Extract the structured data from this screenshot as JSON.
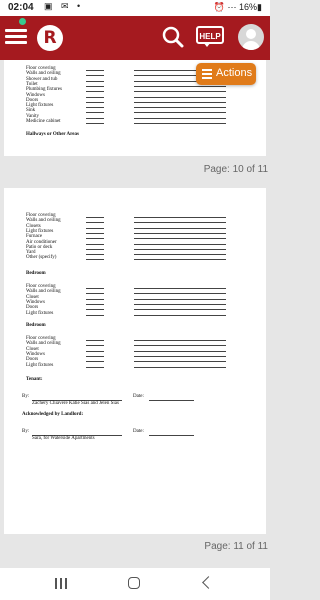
{
  "status_bar": {
    "time": "02:04",
    "notifications": "▣ ✉ •",
    "right": "⏰ ⋯ 16%▮"
  },
  "app_bar": {
    "logo": "R",
    "help_label": "HELP",
    "actions_label": "Actions"
  },
  "page10": {
    "items": [
      "Floor covering",
      "Walls and ceiling",
      "Shower and tub",
      "Toilet",
      "Plumbing fixtures",
      "Windows",
      "Doors",
      "Light fixtures",
      "Sink",
      "Vanity",
      "Medicine cabinet"
    ],
    "heading": "Hallways or Other Areas",
    "page_label": "Page: 10 of 11"
  },
  "page11": {
    "section1": [
      "Floor covering",
      "Walls and ceiling",
      "Closets",
      "Light fixtures",
      "Furnace",
      "Air conditioner",
      "Patio or deck",
      "Yard",
      "Other (specify)"
    ],
    "bedroom1_heading": "Bedroom",
    "bedroom1": [
      "Floor covering",
      "Walls and ceiling",
      "Closet",
      "Windows",
      "Doors",
      "Light fixtures"
    ],
    "bedroom2_heading": "Bedroom",
    "bedroom2": [
      "Floor covering",
      "Walls and ceiling",
      "Closet",
      "Windows",
      "Doors",
      "Light fixtures"
    ],
    "tenant_heading": "Tenant:",
    "by1": "By:",
    "date1": "Date:",
    "signers": "Zachery Chiavere Katie Sias and Jelen Sias",
    "landlord_heading": "Acknowledged by Landlord:",
    "by2": "By:",
    "date2": "Date:",
    "landlord_name": "Sara, for Waterside Apartments",
    "page_label": "Page: 11 of 11"
  }
}
